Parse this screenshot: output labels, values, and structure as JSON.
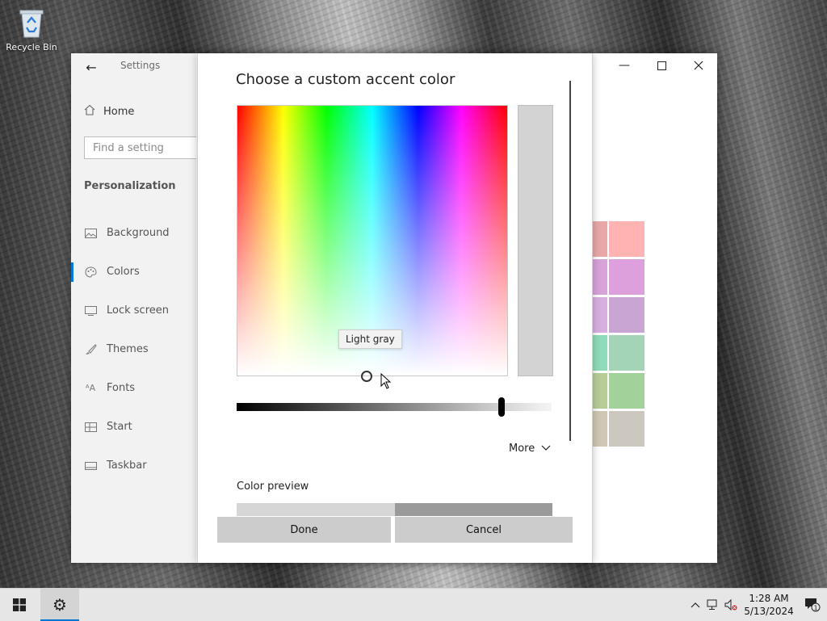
{
  "desktop": {
    "recycle_bin_label": "Recycle Bin"
  },
  "settings": {
    "app_title": "Settings",
    "home_label": "Home",
    "search_placeholder": "Find a setting",
    "section_header": "Personalization",
    "nav_items": [
      {
        "label": "Background",
        "icon": "picture-icon",
        "active": false
      },
      {
        "label": "Colors",
        "icon": "palette-icon",
        "active": true
      },
      {
        "label": "Lock screen",
        "icon": "lock-screen-icon",
        "active": false
      },
      {
        "label": "Themes",
        "icon": "brush-icon",
        "active": false
      },
      {
        "label": "Fonts",
        "icon": "font-icon",
        "active": false
      },
      {
        "label": "Start",
        "icon": "start-grid-icon",
        "active": false
      },
      {
        "label": "Taskbar",
        "icon": "taskbar-icon",
        "active": false
      }
    ],
    "swatch_colors": [
      "#e8a8a8",
      "#ffb3b3",
      "#d9a3d9",
      "#dda0dd",
      "#d8b0e0",
      "#c9a5d4",
      "#8fdcb8",
      "#a3d4b8",
      "#b8cc98",
      "#a3d19a",
      "#cfc8b3",
      "#ccc8c0"
    ]
  },
  "dialog": {
    "title": "Choose a custom accent color",
    "tooltip": "Light gray",
    "selected_color": "#d3d3d3",
    "more_label": "More",
    "preview_label": "Color preview",
    "done_label": "Done",
    "cancel_label": "Cancel"
  },
  "taskbar": {
    "time": "1:28 AM",
    "date": "5/13/2024",
    "notification_count": "1"
  }
}
